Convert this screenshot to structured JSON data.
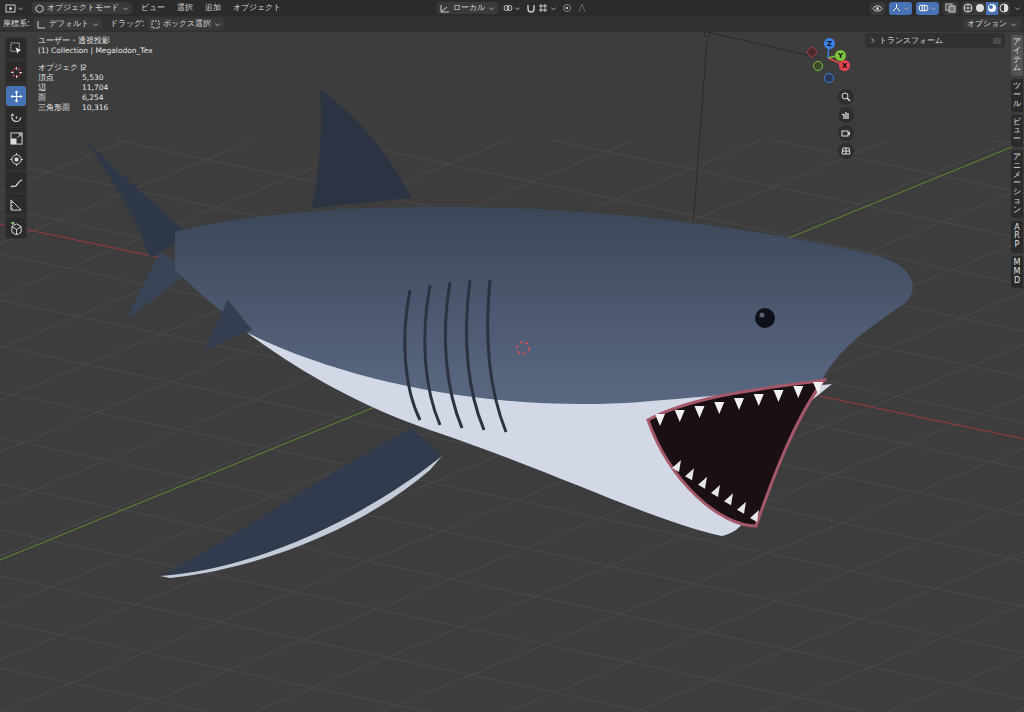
{
  "header": {
    "mode": "オブジェクトモード",
    "menus": [
      "ビュー",
      "選択",
      "追加",
      "オブジェクト"
    ],
    "pivot": "ローカル",
    "toggles": [
      {
        "kind": "visibility",
        "on": false
      },
      {
        "kind": "gizmo",
        "on": true
      },
      {
        "kind": "overlay",
        "on": true
      },
      {
        "kind": "xray",
        "on": false
      }
    ],
    "shading": [
      {
        "kind": "wireframe",
        "selected": false
      },
      {
        "kind": "solid",
        "selected": false
      },
      {
        "kind": "material",
        "selected": true
      },
      {
        "kind": "rendered",
        "selected": false
      }
    ]
  },
  "tool_settings": {
    "orientation_label": "座標系:",
    "orientation": "デフォルト",
    "drag_label": "ドラッグ:",
    "drag": "ボックス選択",
    "options": "オプション"
  },
  "viewport": {
    "view_name": "ユーザー・透視投影",
    "collection": "(1) Collection | Megalodon_Tex",
    "stats": [
      {
        "label": "オブジェクト",
        "value": "2"
      },
      {
        "label": "頂点",
        "value": "5,530"
      },
      {
        "label": "辺",
        "value": "11,704"
      },
      {
        "label": "面",
        "value": "6,254"
      },
      {
        "label": "三角形面",
        "value": "10,316"
      }
    ]
  },
  "toolbar": [
    {
      "kind": "select",
      "selected": false
    },
    {
      "kind": "cursor",
      "selected": false
    },
    {
      "kind": "move",
      "selected": true
    },
    {
      "kind": "rotate",
      "selected": false
    },
    {
      "kind": "scale",
      "selected": false
    },
    {
      "kind": "transform",
      "selected": false
    },
    {
      "kind": "annotate",
      "selected": false
    },
    {
      "kind": "measure",
      "selected": false
    },
    {
      "kind": "add",
      "selected": false
    }
  ],
  "gizmo": {
    "axes": [
      {
        "label": "X",
        "color": "#e8434f"
      },
      {
        "label": "Y",
        "color": "#7cc23c"
      },
      {
        "label": "Z",
        "color": "#3b82e8"
      }
    ]
  },
  "sidebar": {
    "panel": {
      "title": "トランスフォーム",
      "expanded": false
    },
    "tabs": [
      {
        "label": "アイテム",
        "selected": true
      },
      {
        "label": "ツール",
        "selected": false
      },
      {
        "label": "ビュー",
        "selected": false
      },
      {
        "label": "アニメーション",
        "selected": false
      },
      {
        "label": "ARP",
        "selected": false
      },
      {
        "label": "MMD",
        "selected": false
      }
    ]
  }
}
